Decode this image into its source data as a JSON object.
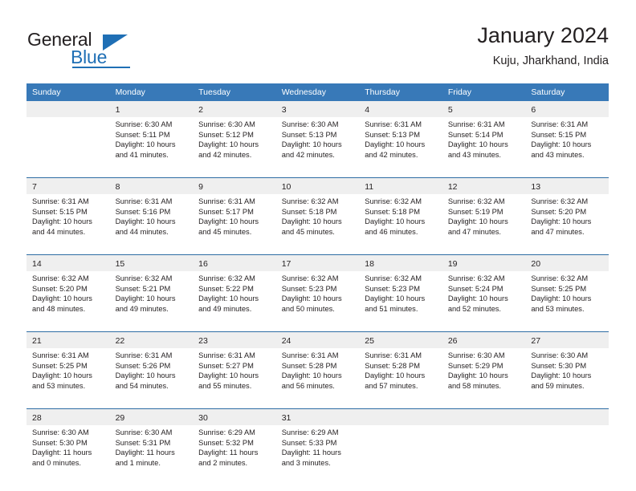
{
  "brand": {
    "name_part1": "General",
    "name_part2": "Blue",
    "accent_color": "#1f6fb5"
  },
  "header": {
    "title": "January 2024",
    "subtitle": "Kuju, Jharkhand, India"
  },
  "theme": {
    "header_row_bg": "#3879b8",
    "daynum_row_bg": "#efefef",
    "separator_color": "#2e6da4"
  },
  "calendar": {
    "weekdays": [
      "Sunday",
      "Monday",
      "Tuesday",
      "Wednesday",
      "Thursday",
      "Friday",
      "Saturday"
    ],
    "weeks": [
      [
        {
          "day": "",
          "sunrise": "",
          "sunset": "",
          "daylight_1": "",
          "daylight_2": ""
        },
        {
          "day": "1",
          "sunrise": "Sunrise: 6:30 AM",
          "sunset": "Sunset: 5:11 PM",
          "daylight_1": "Daylight: 10 hours",
          "daylight_2": "and 41 minutes."
        },
        {
          "day": "2",
          "sunrise": "Sunrise: 6:30 AM",
          "sunset": "Sunset: 5:12 PM",
          "daylight_1": "Daylight: 10 hours",
          "daylight_2": "and 42 minutes."
        },
        {
          "day": "3",
          "sunrise": "Sunrise: 6:30 AM",
          "sunset": "Sunset: 5:13 PM",
          "daylight_1": "Daylight: 10 hours",
          "daylight_2": "and 42 minutes."
        },
        {
          "day": "4",
          "sunrise": "Sunrise: 6:31 AM",
          "sunset": "Sunset: 5:13 PM",
          "daylight_1": "Daylight: 10 hours",
          "daylight_2": "and 42 minutes."
        },
        {
          "day": "5",
          "sunrise": "Sunrise: 6:31 AM",
          "sunset": "Sunset: 5:14 PM",
          "daylight_1": "Daylight: 10 hours",
          "daylight_2": "and 43 minutes."
        },
        {
          "day": "6",
          "sunrise": "Sunrise: 6:31 AM",
          "sunset": "Sunset: 5:15 PM",
          "daylight_1": "Daylight: 10 hours",
          "daylight_2": "and 43 minutes."
        }
      ],
      [
        {
          "day": "7",
          "sunrise": "Sunrise: 6:31 AM",
          "sunset": "Sunset: 5:15 PM",
          "daylight_1": "Daylight: 10 hours",
          "daylight_2": "and 44 minutes."
        },
        {
          "day": "8",
          "sunrise": "Sunrise: 6:31 AM",
          "sunset": "Sunset: 5:16 PM",
          "daylight_1": "Daylight: 10 hours",
          "daylight_2": "and 44 minutes."
        },
        {
          "day": "9",
          "sunrise": "Sunrise: 6:31 AM",
          "sunset": "Sunset: 5:17 PM",
          "daylight_1": "Daylight: 10 hours",
          "daylight_2": "and 45 minutes."
        },
        {
          "day": "10",
          "sunrise": "Sunrise: 6:32 AM",
          "sunset": "Sunset: 5:18 PM",
          "daylight_1": "Daylight: 10 hours",
          "daylight_2": "and 45 minutes."
        },
        {
          "day": "11",
          "sunrise": "Sunrise: 6:32 AM",
          "sunset": "Sunset: 5:18 PM",
          "daylight_1": "Daylight: 10 hours",
          "daylight_2": "and 46 minutes."
        },
        {
          "day": "12",
          "sunrise": "Sunrise: 6:32 AM",
          "sunset": "Sunset: 5:19 PM",
          "daylight_1": "Daylight: 10 hours",
          "daylight_2": "and 47 minutes."
        },
        {
          "day": "13",
          "sunrise": "Sunrise: 6:32 AM",
          "sunset": "Sunset: 5:20 PM",
          "daylight_1": "Daylight: 10 hours",
          "daylight_2": "and 47 minutes."
        }
      ],
      [
        {
          "day": "14",
          "sunrise": "Sunrise: 6:32 AM",
          "sunset": "Sunset: 5:20 PM",
          "daylight_1": "Daylight: 10 hours",
          "daylight_2": "and 48 minutes."
        },
        {
          "day": "15",
          "sunrise": "Sunrise: 6:32 AM",
          "sunset": "Sunset: 5:21 PM",
          "daylight_1": "Daylight: 10 hours",
          "daylight_2": "and 49 minutes."
        },
        {
          "day": "16",
          "sunrise": "Sunrise: 6:32 AM",
          "sunset": "Sunset: 5:22 PM",
          "daylight_1": "Daylight: 10 hours",
          "daylight_2": "and 49 minutes."
        },
        {
          "day": "17",
          "sunrise": "Sunrise: 6:32 AM",
          "sunset": "Sunset: 5:23 PM",
          "daylight_1": "Daylight: 10 hours",
          "daylight_2": "and 50 minutes."
        },
        {
          "day": "18",
          "sunrise": "Sunrise: 6:32 AM",
          "sunset": "Sunset: 5:23 PM",
          "daylight_1": "Daylight: 10 hours",
          "daylight_2": "and 51 minutes."
        },
        {
          "day": "19",
          "sunrise": "Sunrise: 6:32 AM",
          "sunset": "Sunset: 5:24 PM",
          "daylight_1": "Daylight: 10 hours",
          "daylight_2": "and 52 minutes."
        },
        {
          "day": "20",
          "sunrise": "Sunrise: 6:32 AM",
          "sunset": "Sunset: 5:25 PM",
          "daylight_1": "Daylight: 10 hours",
          "daylight_2": "and 53 minutes."
        }
      ],
      [
        {
          "day": "21",
          "sunrise": "Sunrise: 6:31 AM",
          "sunset": "Sunset: 5:25 PM",
          "daylight_1": "Daylight: 10 hours",
          "daylight_2": "and 53 minutes."
        },
        {
          "day": "22",
          "sunrise": "Sunrise: 6:31 AM",
          "sunset": "Sunset: 5:26 PM",
          "daylight_1": "Daylight: 10 hours",
          "daylight_2": "and 54 minutes."
        },
        {
          "day": "23",
          "sunrise": "Sunrise: 6:31 AM",
          "sunset": "Sunset: 5:27 PM",
          "daylight_1": "Daylight: 10 hours",
          "daylight_2": "and 55 minutes."
        },
        {
          "day": "24",
          "sunrise": "Sunrise: 6:31 AM",
          "sunset": "Sunset: 5:28 PM",
          "daylight_1": "Daylight: 10 hours",
          "daylight_2": "and 56 minutes."
        },
        {
          "day": "25",
          "sunrise": "Sunrise: 6:31 AM",
          "sunset": "Sunset: 5:28 PM",
          "daylight_1": "Daylight: 10 hours",
          "daylight_2": "and 57 minutes."
        },
        {
          "day": "26",
          "sunrise": "Sunrise: 6:30 AM",
          "sunset": "Sunset: 5:29 PM",
          "daylight_1": "Daylight: 10 hours",
          "daylight_2": "and 58 minutes."
        },
        {
          "day": "27",
          "sunrise": "Sunrise: 6:30 AM",
          "sunset": "Sunset: 5:30 PM",
          "daylight_1": "Daylight: 10 hours",
          "daylight_2": "and 59 minutes."
        }
      ],
      [
        {
          "day": "28",
          "sunrise": "Sunrise: 6:30 AM",
          "sunset": "Sunset: 5:30 PM",
          "daylight_1": "Daylight: 11 hours",
          "daylight_2": "and 0 minutes."
        },
        {
          "day": "29",
          "sunrise": "Sunrise: 6:30 AM",
          "sunset": "Sunset: 5:31 PM",
          "daylight_1": "Daylight: 11 hours",
          "daylight_2": "and 1 minute."
        },
        {
          "day": "30",
          "sunrise": "Sunrise: 6:29 AM",
          "sunset": "Sunset: 5:32 PM",
          "daylight_1": "Daylight: 11 hours",
          "daylight_2": "and 2 minutes."
        },
        {
          "day": "31",
          "sunrise": "Sunrise: 6:29 AM",
          "sunset": "Sunset: 5:33 PM",
          "daylight_1": "Daylight: 11 hours",
          "daylight_2": "and 3 minutes."
        },
        {
          "day": "",
          "sunrise": "",
          "sunset": "",
          "daylight_1": "",
          "daylight_2": ""
        },
        {
          "day": "",
          "sunrise": "",
          "sunset": "",
          "daylight_1": "",
          "daylight_2": ""
        },
        {
          "day": "",
          "sunrise": "",
          "sunset": "",
          "daylight_1": "",
          "daylight_2": ""
        }
      ]
    ]
  }
}
